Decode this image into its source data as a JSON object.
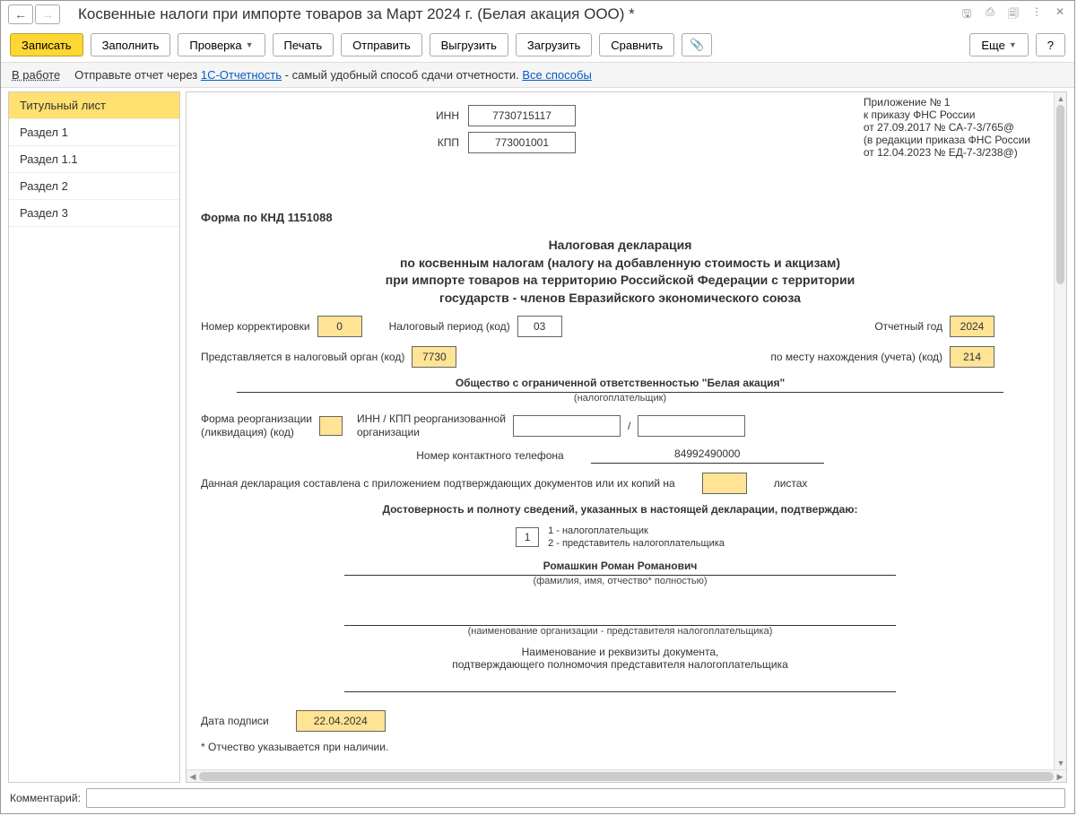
{
  "title": "Косвенные налоги при импорте товаров за Март 2024 г. (Белая акация ООО) *",
  "toolbar": {
    "save": "Записать",
    "fill": "Заполнить",
    "check": "Проверка",
    "print": "Печать",
    "send": "Отправить",
    "export": "Выгрузить",
    "import": "Загрузить",
    "compare": "Сравнить",
    "more": "Еще",
    "help": "?"
  },
  "infobar": {
    "status": "В работе",
    "text_prefix": "Отправьте отчет через ",
    "link1": "1С-Отчетность",
    "text_suffix": " - самый удобный способ сдачи отчетности. ",
    "link2": "Все способы"
  },
  "sidebar": {
    "items": [
      {
        "label": "Титульный лист",
        "active": true
      },
      {
        "label": "Раздел 1",
        "active": false
      },
      {
        "label": "Раздел 1.1",
        "active": false
      },
      {
        "label": "Раздел 2",
        "active": false
      },
      {
        "label": "Раздел 3",
        "active": false
      }
    ]
  },
  "appendix": {
    "l1": "Приложение № 1",
    "l2": "к приказу ФНС России",
    "l3": "от 27.09.2017 № СА-7-3/765@",
    "l4": "(в редакции приказа ФНС России",
    "l5": "от 12.04.2023 № ЕД-7-3/238@)"
  },
  "form": {
    "inn_label": "ИНН",
    "inn": "7730715117",
    "kpp_label": "КПП",
    "kpp": "773001001",
    "knd": "Форма по КНД 1151088",
    "title1": "Налоговая декларация",
    "title2": "по косвенным налогам (налогу на добавленную стоимость и акцизам)",
    "title3": "при импорте товаров на территорию Российской Федерации с территории",
    "title4": "государств - членов Евразийского экономического союза",
    "corr_label": "Номер корректировки",
    "corr": "0",
    "period_label": "Налоговый период (код)",
    "period": "03",
    "year_label": "Отчетный год",
    "year": "2024",
    "organ_label": "Представляется в налоговый орган (код)",
    "organ": "7730",
    "place_label": "по месту нахождения (учета) (код)",
    "place": "214",
    "taxpayer": "Общество с ограниченной ответственностью \"Белая акация\"",
    "taxpayer_cap": "(налогоплательщик)",
    "reorg_form_label1": "Форма реорганизации",
    "reorg_form_label2": "(ликвидация) (код)",
    "reorg_innkpp_label1": "ИНН / КПП реорганизованной",
    "reorg_innkpp_label2": "организации",
    "slash": "/",
    "phone_label": "Номер контактного телефона",
    "phone": "84992490000",
    "docs_text1": "Данная декларация составлена с приложением подтверждающих документов или их копий на",
    "docs_text2": "листах",
    "confirm_title": "Достоверность и полноту сведений, указанных в настоящей декларации, подтверждаю:",
    "confirm_code": "1",
    "confirm_opt1": "1 - налогоплательщик",
    "confirm_opt2": "2 - представитель налогоплательщика",
    "fio": "Ромашкин Роман Романович",
    "fio_cap": "(фамилия, имя, отчество* полностью)",
    "repr_org_cap": "(наименование организации - представителя налогоплательщика)",
    "doc_name1": "Наименование и реквизиты документа,",
    "doc_name2": "подтверждающего полномочия представителя налогоплательщика",
    "sign_date_label": "Дата подписи",
    "sign_date": "22.04.2024",
    "footnote": "*  Отчество указывается при наличии."
  },
  "footer": {
    "label": "Комментарий:"
  }
}
